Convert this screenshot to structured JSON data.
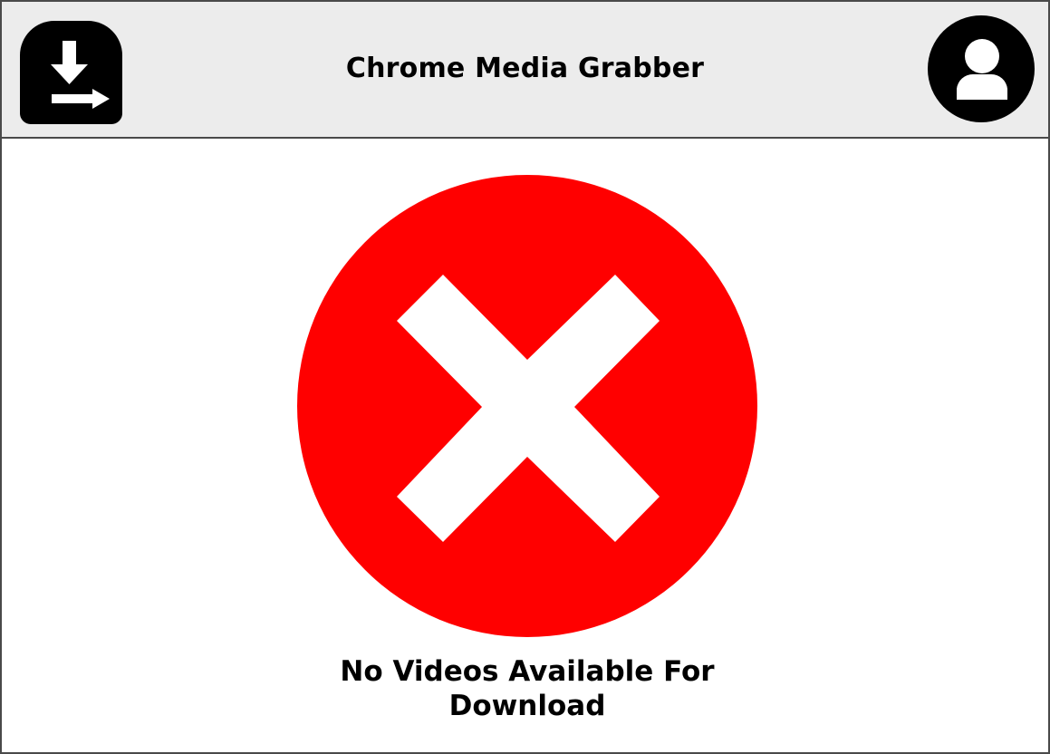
{
  "header": {
    "title": "Chrome Media Grabber",
    "logo_icon": "download-arrow-icon",
    "profile_icon": "user-avatar-icon"
  },
  "main": {
    "status_icon": "error-x-icon",
    "message_line1": "No Videos Available For",
    "message_line2": "Download"
  },
  "colors": {
    "header_bg": "#ececec",
    "border": "#4a4a4a",
    "error_red": "#ff0000",
    "icon_black": "#000000"
  }
}
